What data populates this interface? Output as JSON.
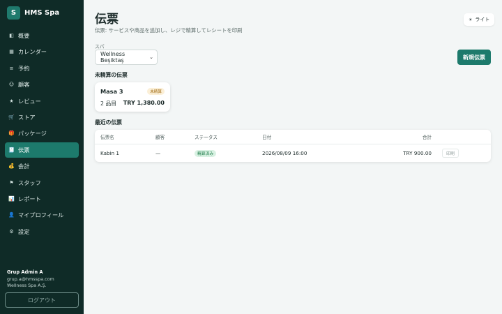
{
  "brand": {
    "logo_letter": "S",
    "name": "HMS Spa"
  },
  "sidebar": {
    "items": [
      {
        "label": "概要",
        "icon": "◧",
        "icon_name": "overview-icon"
      },
      {
        "label": "カレンダー",
        "icon": "▦",
        "icon_name": "calendar-icon"
      },
      {
        "label": "予約",
        "icon": "≡",
        "icon_name": "list-icon"
      },
      {
        "label": "顧客",
        "icon": "☺",
        "icon_name": "customer-icon"
      },
      {
        "label": "レビュー",
        "icon": "★",
        "icon_name": "star-icon"
      },
      {
        "label": "ストア",
        "icon": "🛒",
        "icon_name": "cart-icon"
      },
      {
        "label": "パッケージ",
        "icon": "🎁",
        "icon_name": "gift-icon"
      },
      {
        "label": "伝票",
        "icon": "🧾",
        "icon_name": "receipt-icon",
        "active": true
      },
      {
        "label": "会計",
        "icon": "💰",
        "icon_name": "money-bag-icon"
      },
      {
        "label": "スタッフ",
        "icon": "⚑",
        "icon_name": "flag-icon"
      },
      {
        "label": "レポート",
        "icon": "📊",
        "icon_name": "chart-icon"
      },
      {
        "label": "マイプロフィール",
        "icon": "👤",
        "icon_name": "profile-icon"
      },
      {
        "label": "設定",
        "icon": "⚙",
        "icon_name": "gear-icon"
      }
    ]
  },
  "user": {
    "name": "Grup Admin A",
    "email": "grup.a@hmsspa.com",
    "company": "Wellness Spa A.Ş."
  },
  "logout_label": "ログアウト",
  "header": {
    "title": "伝票",
    "subtitle": "伝票: サービスや商品を追加し、レジで精算してレシートを印刷",
    "theme_label": "ライト",
    "theme_icon": "☀"
  },
  "filter": {
    "spa_label": "スパ",
    "spa_value": "Wellness Beşiktaş",
    "chevron": "⌄"
  },
  "new_button_label": "新規伝票",
  "open_section": {
    "title": "未精算の伝票",
    "cards": [
      {
        "name": "Masa 3",
        "badge": "未精算",
        "count": "2 品目",
        "total": "TRY 1,380.00"
      }
    ]
  },
  "recent_section": {
    "title": "最近の伝票",
    "columns": [
      "伝票名",
      "顧客",
      "ステータス",
      "日付",
      "合計"
    ],
    "rows": [
      {
        "name": "Kabin 1",
        "customer": "—",
        "status": "精算済み",
        "date": "2026/08/09 16:00",
        "total": "TRY 900.00",
        "action": "印刷"
      }
    ]
  },
  "colors": {
    "sidebar_bg": "#0f2b27",
    "accent": "#1d7a6c",
    "page_bg": "#f3f6f6"
  }
}
